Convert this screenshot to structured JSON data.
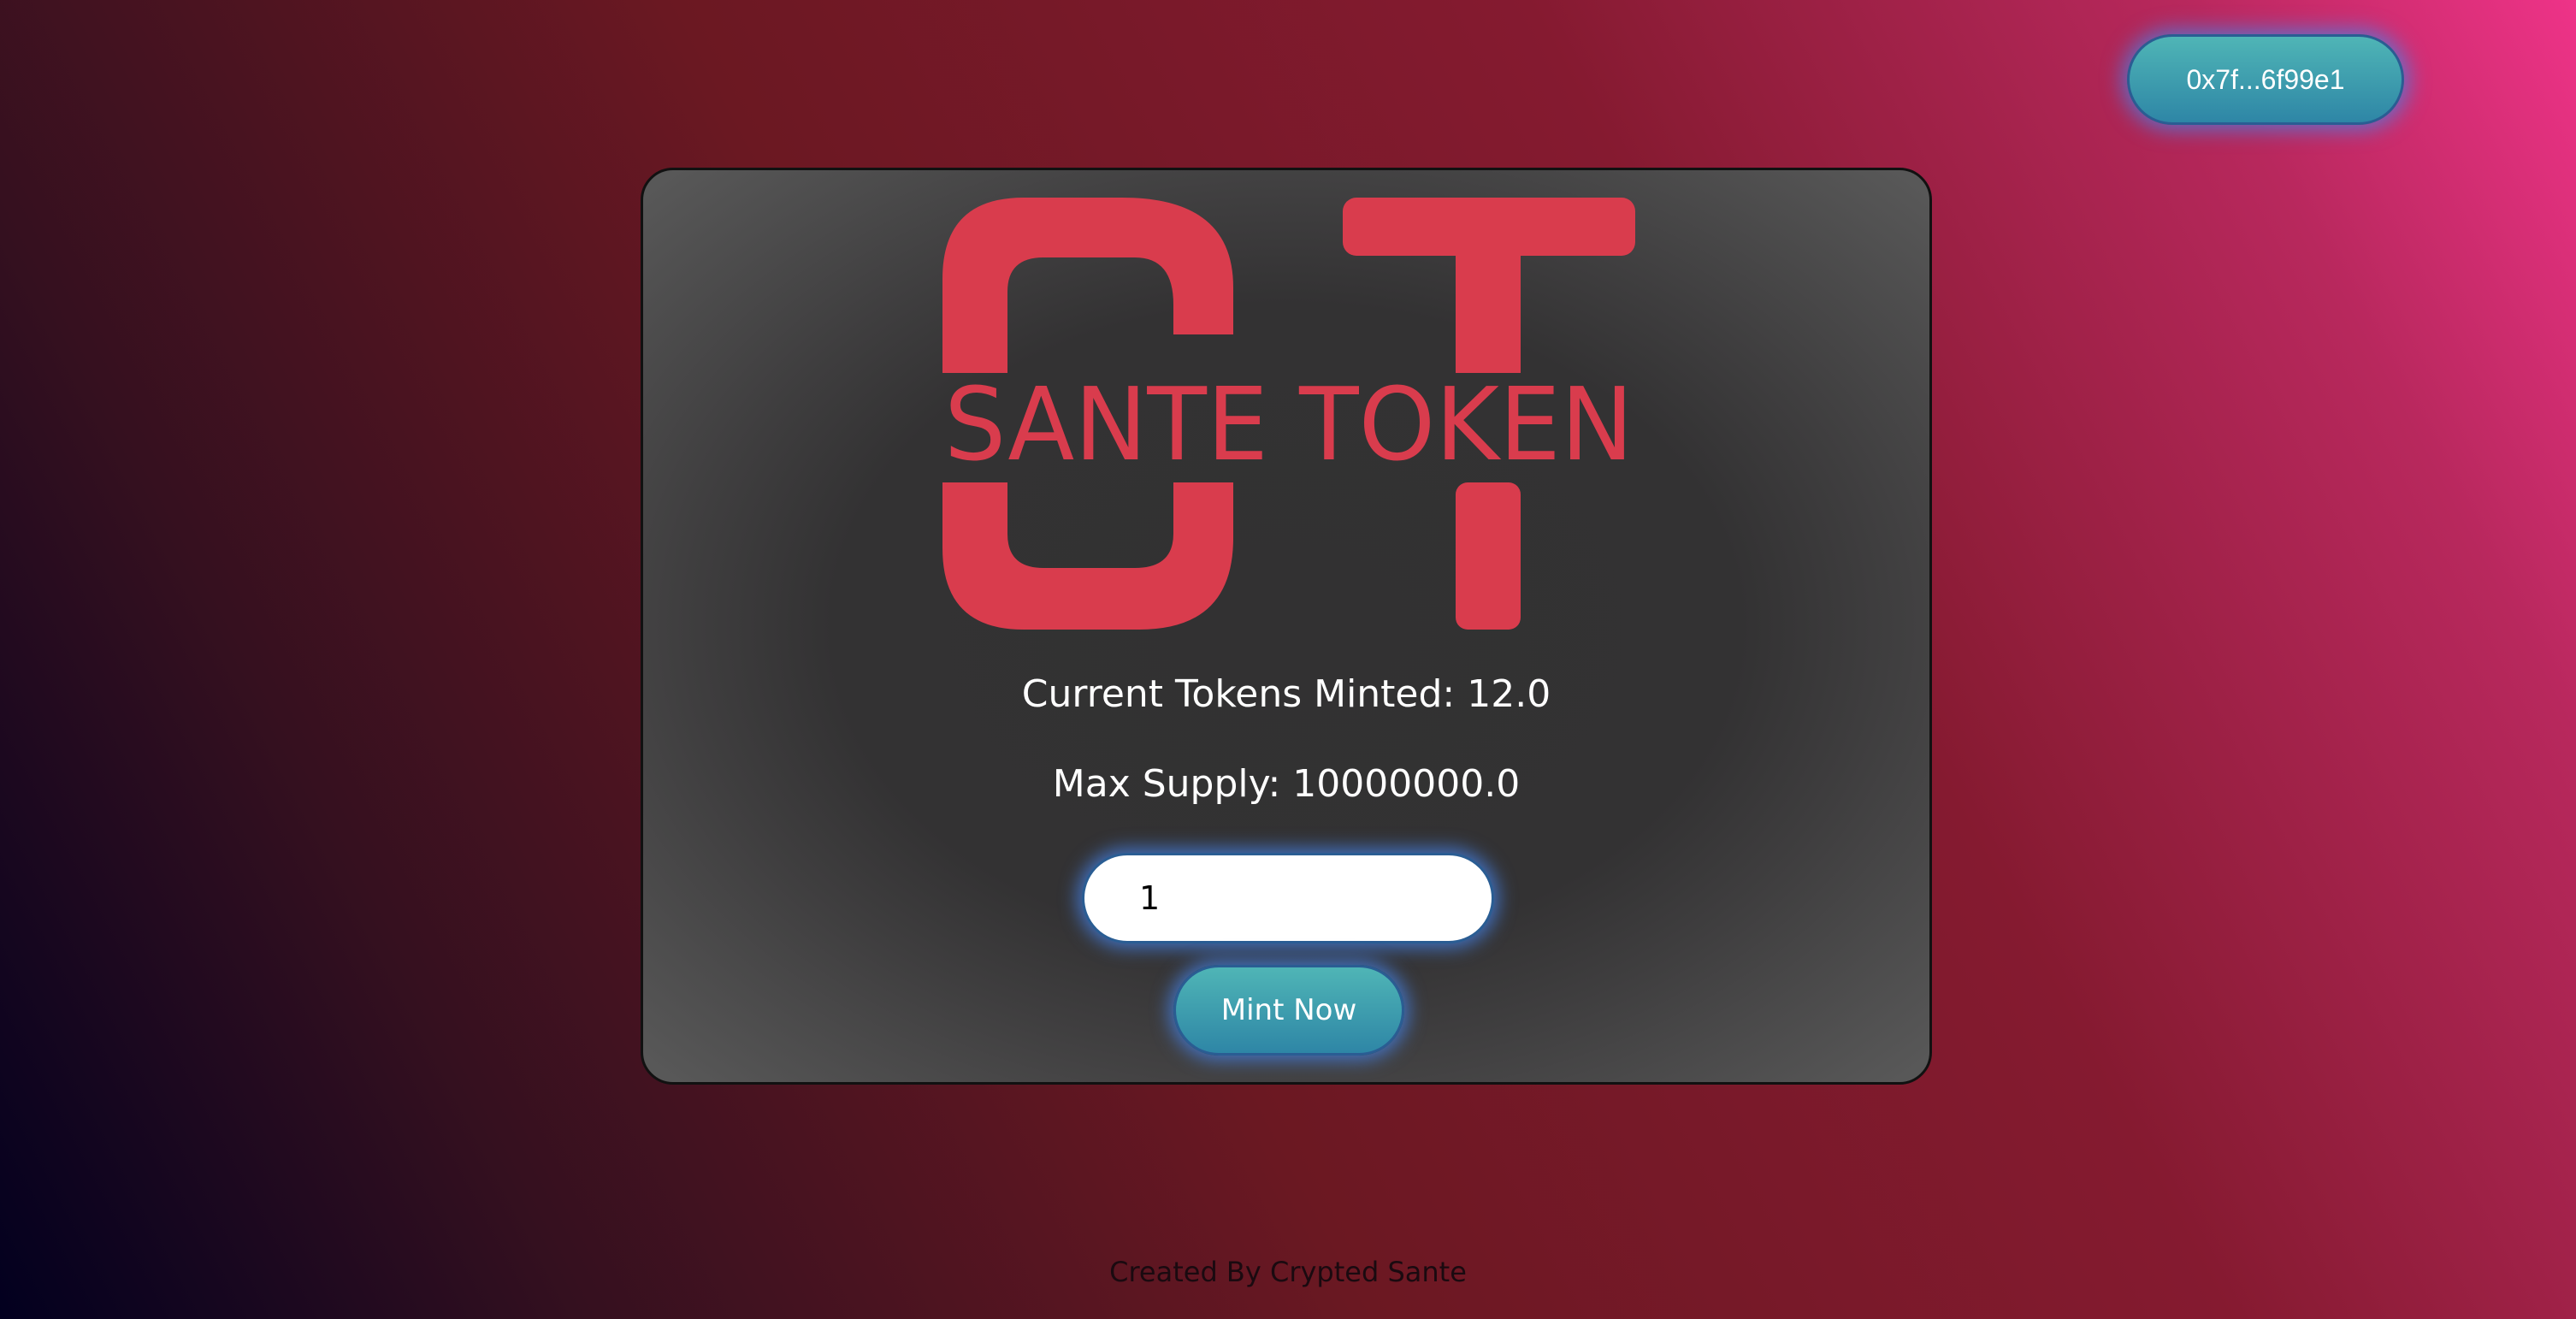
{
  "header": {
    "wallet_address": "0x7f...6f99e1"
  },
  "mint_card": {
    "logo": {
      "monogram_letters": "ST",
      "wordmark": "SANTE TOKEN",
      "color": "#d93c4d"
    },
    "tokens_minted_text": "Current Tokens Minted: 12.0",
    "max_supply_text": "Max Supply: 10000000.0",
    "amount_input": {
      "value": "1"
    },
    "mint_button_label": "Mint Now"
  },
  "footer": {
    "credit_text": "Created By Crypted Sante"
  },
  "colors": {
    "button_teal": "#4fb5b6",
    "button_glow": "#4682e6",
    "card_background": "#333233",
    "logo_red": "#d93c4d"
  }
}
